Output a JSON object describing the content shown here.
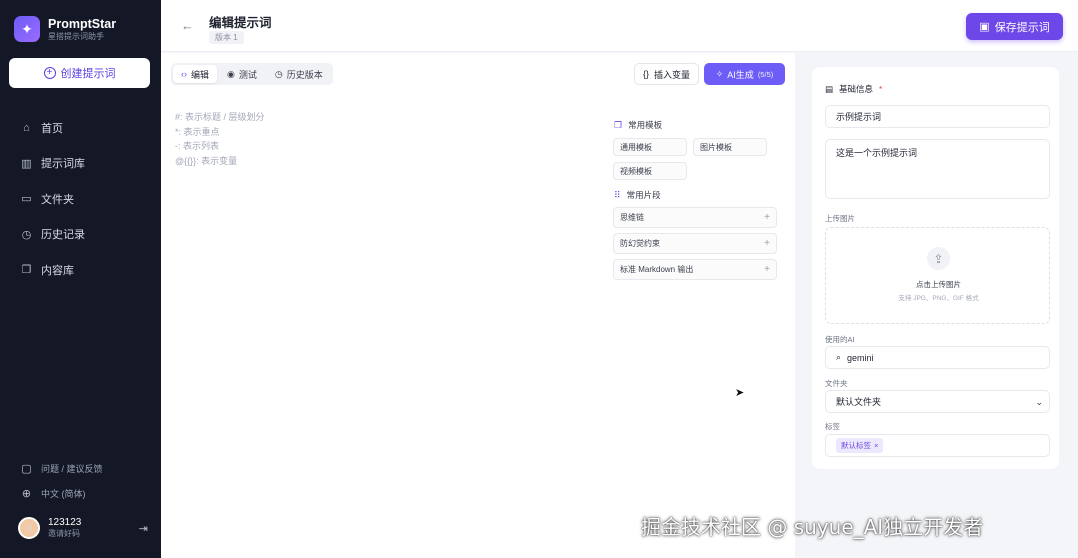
{
  "brand": {
    "name": "PromptStar",
    "subtitle": "星搭提示词助手",
    "logo_icon": "sparkle-icon"
  },
  "sidebar": {
    "create_label": "创建提示词",
    "items": [
      {
        "label": "首页",
        "icon": "home-icon"
      },
      {
        "label": "提示词库",
        "icon": "library-icon"
      },
      {
        "label": "文件夹",
        "icon": "folder-icon"
      },
      {
        "label": "历史记录",
        "icon": "history-icon"
      },
      {
        "label": "内容库",
        "icon": "content-icon"
      }
    ],
    "footer": [
      {
        "label": "问题 / 建议反馈",
        "icon": "feedback-icon"
      },
      {
        "label": "中文 (简体)",
        "icon": "globe-icon"
      }
    ],
    "user": {
      "name": "123123",
      "subtitle": "邀请好码"
    }
  },
  "header": {
    "title": "编辑提示词",
    "version": "版本 1",
    "save_label": "保存提示词"
  },
  "editor": {
    "tabs": [
      {
        "label": "编辑",
        "icon": "code-icon",
        "active": true
      },
      {
        "label": "测试",
        "icon": "eye-icon",
        "active": false
      },
      {
        "label": "历史版本",
        "icon": "clock-icon",
        "active": false
      }
    ],
    "insert_variable_label": "插入变量",
    "ai_generate_label": "AI生成",
    "ai_generate_count": "(5/5)",
    "placeholder_lines": [
      "#: 表示标题 / 层级划分",
      "*: 表示重点",
      "-: 表示列表",
      "@{{}}: 表示变量"
    ],
    "common_templates_title": "常用模板",
    "templates": [
      "通用模板",
      "图片模板",
      "视频模板"
    ],
    "common_snippets_title": "常用片段",
    "snippets": [
      "思维链",
      "防幻觉约束",
      "标准 Markdown 输出"
    ]
  },
  "form": {
    "section_title": "基础信息",
    "name_value": "示例提示词",
    "description_value": "这是一个示例提示词",
    "upload_label": "上传图片",
    "upload_text": "点击上传图片",
    "upload_hint": "支持 JPG、PNG、GIF 格式",
    "ai_label": "使用的AI",
    "ai_value": "gemini",
    "folder_label": "文件夹",
    "folder_value": "默认文件夹",
    "tags_label": "标签",
    "tag_value": "默认标签"
  },
  "watermark": "掘金技术社区 @ suyue_AI独立开发者",
  "colors": {
    "accent": "#6d47e8",
    "sidebar_bg": "#141826"
  }
}
